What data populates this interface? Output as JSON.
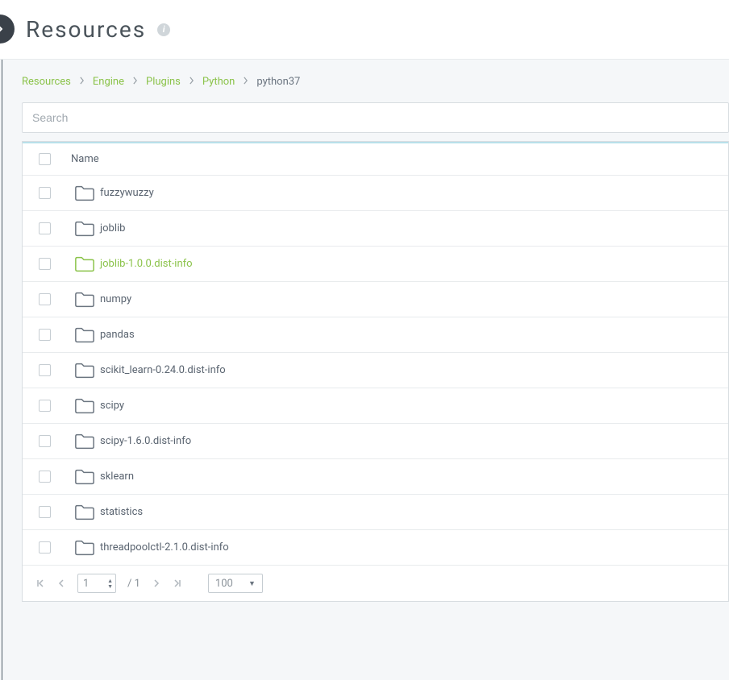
{
  "header": {
    "title": "Resources",
    "info_glyph": "i"
  },
  "breadcrumb": {
    "items": [
      "Resources",
      "Engine",
      "Plugins",
      "Python"
    ],
    "current": "python37"
  },
  "search": {
    "placeholder": "Search",
    "value": ""
  },
  "table": {
    "column_name": "Name",
    "rows": [
      {
        "name": "fuzzywuzzy",
        "highlight": false
      },
      {
        "name": "joblib",
        "highlight": false
      },
      {
        "name": "joblib-1.0.0.dist-info",
        "highlight": true
      },
      {
        "name": "numpy",
        "highlight": false
      },
      {
        "name": "pandas",
        "highlight": false
      },
      {
        "name": "scikit_learn-0.24.0.dist-info",
        "highlight": false
      },
      {
        "name": "scipy",
        "highlight": false
      },
      {
        "name": "scipy-1.6.0.dist-info",
        "highlight": false
      },
      {
        "name": "sklearn",
        "highlight": false
      },
      {
        "name": "statistics",
        "highlight": false
      },
      {
        "name": "threadpoolctl-2.1.0.dist-info",
        "highlight": false
      }
    ]
  },
  "pager": {
    "current_page": "1",
    "total_pages_label": "/ 1",
    "page_size": "100"
  }
}
